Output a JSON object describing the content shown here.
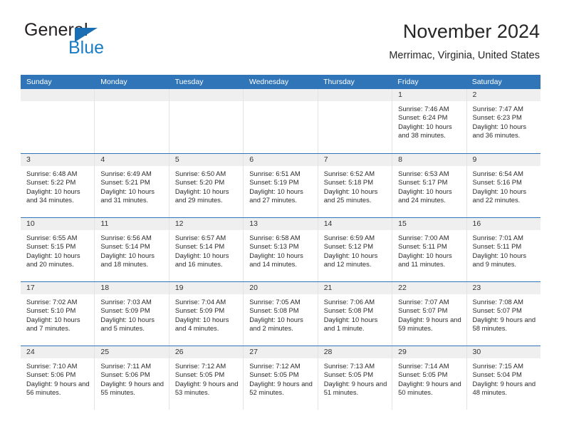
{
  "logo": {
    "word_one": "General",
    "word_two": "Blue",
    "triangle_color": "#1a6fb4",
    "blue_color": "#1a7dc4"
  },
  "header": {
    "month_title": "November 2024",
    "location": "Merrimac, Virginia, United States",
    "header_bg": "#3075b8"
  },
  "calendar": {
    "day_headers": [
      "Sunday",
      "Monday",
      "Tuesday",
      "Wednesday",
      "Thursday",
      "Friday",
      "Saturday"
    ],
    "weeks": [
      [
        {
          "day": "",
          "empty": true
        },
        {
          "day": "",
          "empty": true
        },
        {
          "day": "",
          "empty": true
        },
        {
          "day": "",
          "empty": true
        },
        {
          "day": "",
          "empty": true
        },
        {
          "day": "1",
          "sunrise": "Sunrise: 7:46 AM",
          "sunset": "Sunset: 6:24 PM",
          "daylight": "Daylight: 10 hours and 38 minutes."
        },
        {
          "day": "2",
          "sunrise": "Sunrise: 7:47 AM",
          "sunset": "Sunset: 6:23 PM",
          "daylight": "Daylight: 10 hours and 36 minutes."
        }
      ],
      [
        {
          "day": "3",
          "sunrise": "Sunrise: 6:48 AM",
          "sunset": "Sunset: 5:22 PM",
          "daylight": "Daylight: 10 hours and 34 minutes."
        },
        {
          "day": "4",
          "sunrise": "Sunrise: 6:49 AM",
          "sunset": "Sunset: 5:21 PM",
          "daylight": "Daylight: 10 hours and 31 minutes."
        },
        {
          "day": "5",
          "sunrise": "Sunrise: 6:50 AM",
          "sunset": "Sunset: 5:20 PM",
          "daylight": "Daylight: 10 hours and 29 minutes."
        },
        {
          "day": "6",
          "sunrise": "Sunrise: 6:51 AM",
          "sunset": "Sunset: 5:19 PM",
          "daylight": "Daylight: 10 hours and 27 minutes."
        },
        {
          "day": "7",
          "sunrise": "Sunrise: 6:52 AM",
          "sunset": "Sunset: 5:18 PM",
          "daylight": "Daylight: 10 hours and 25 minutes."
        },
        {
          "day": "8",
          "sunrise": "Sunrise: 6:53 AM",
          "sunset": "Sunset: 5:17 PM",
          "daylight": "Daylight: 10 hours and 24 minutes."
        },
        {
          "day": "9",
          "sunrise": "Sunrise: 6:54 AM",
          "sunset": "Sunset: 5:16 PM",
          "daylight": "Daylight: 10 hours and 22 minutes."
        }
      ],
      [
        {
          "day": "10",
          "sunrise": "Sunrise: 6:55 AM",
          "sunset": "Sunset: 5:15 PM",
          "daylight": "Daylight: 10 hours and 20 minutes."
        },
        {
          "day": "11",
          "sunrise": "Sunrise: 6:56 AM",
          "sunset": "Sunset: 5:14 PM",
          "daylight": "Daylight: 10 hours and 18 minutes."
        },
        {
          "day": "12",
          "sunrise": "Sunrise: 6:57 AM",
          "sunset": "Sunset: 5:14 PM",
          "daylight": "Daylight: 10 hours and 16 minutes."
        },
        {
          "day": "13",
          "sunrise": "Sunrise: 6:58 AM",
          "sunset": "Sunset: 5:13 PM",
          "daylight": "Daylight: 10 hours and 14 minutes."
        },
        {
          "day": "14",
          "sunrise": "Sunrise: 6:59 AM",
          "sunset": "Sunset: 5:12 PM",
          "daylight": "Daylight: 10 hours and 12 minutes."
        },
        {
          "day": "15",
          "sunrise": "Sunrise: 7:00 AM",
          "sunset": "Sunset: 5:11 PM",
          "daylight": "Daylight: 10 hours and 11 minutes."
        },
        {
          "day": "16",
          "sunrise": "Sunrise: 7:01 AM",
          "sunset": "Sunset: 5:11 PM",
          "daylight": "Daylight: 10 hours and 9 minutes."
        }
      ],
      [
        {
          "day": "17",
          "sunrise": "Sunrise: 7:02 AM",
          "sunset": "Sunset: 5:10 PM",
          "daylight": "Daylight: 10 hours and 7 minutes."
        },
        {
          "day": "18",
          "sunrise": "Sunrise: 7:03 AM",
          "sunset": "Sunset: 5:09 PM",
          "daylight": "Daylight: 10 hours and 5 minutes."
        },
        {
          "day": "19",
          "sunrise": "Sunrise: 7:04 AM",
          "sunset": "Sunset: 5:09 PM",
          "daylight": "Daylight: 10 hours and 4 minutes."
        },
        {
          "day": "20",
          "sunrise": "Sunrise: 7:05 AM",
          "sunset": "Sunset: 5:08 PM",
          "daylight": "Daylight: 10 hours and 2 minutes."
        },
        {
          "day": "21",
          "sunrise": "Sunrise: 7:06 AM",
          "sunset": "Sunset: 5:08 PM",
          "daylight": "Daylight: 10 hours and 1 minute."
        },
        {
          "day": "22",
          "sunrise": "Sunrise: 7:07 AM",
          "sunset": "Sunset: 5:07 PM",
          "daylight": "Daylight: 9 hours and 59 minutes."
        },
        {
          "day": "23",
          "sunrise": "Sunrise: 7:08 AM",
          "sunset": "Sunset: 5:07 PM",
          "daylight": "Daylight: 9 hours and 58 minutes."
        }
      ],
      [
        {
          "day": "24",
          "sunrise": "Sunrise: 7:10 AM",
          "sunset": "Sunset: 5:06 PM",
          "daylight": "Daylight: 9 hours and 56 minutes."
        },
        {
          "day": "25",
          "sunrise": "Sunrise: 7:11 AM",
          "sunset": "Sunset: 5:06 PM",
          "daylight": "Daylight: 9 hours and 55 minutes."
        },
        {
          "day": "26",
          "sunrise": "Sunrise: 7:12 AM",
          "sunset": "Sunset: 5:05 PM",
          "daylight": "Daylight: 9 hours and 53 minutes."
        },
        {
          "day": "27",
          "sunrise": "Sunrise: 7:12 AM",
          "sunset": "Sunset: 5:05 PM",
          "daylight": "Daylight: 9 hours and 52 minutes."
        },
        {
          "day": "28",
          "sunrise": "Sunrise: 7:13 AM",
          "sunset": "Sunset: 5:05 PM",
          "daylight": "Daylight: 9 hours and 51 minutes."
        },
        {
          "day": "29",
          "sunrise": "Sunrise: 7:14 AM",
          "sunset": "Sunset: 5:05 PM",
          "daylight": "Daylight: 9 hours and 50 minutes."
        },
        {
          "day": "30",
          "sunrise": "Sunrise: 7:15 AM",
          "sunset": "Sunset: 5:04 PM",
          "daylight": "Daylight: 9 hours and 48 minutes."
        }
      ]
    ]
  }
}
